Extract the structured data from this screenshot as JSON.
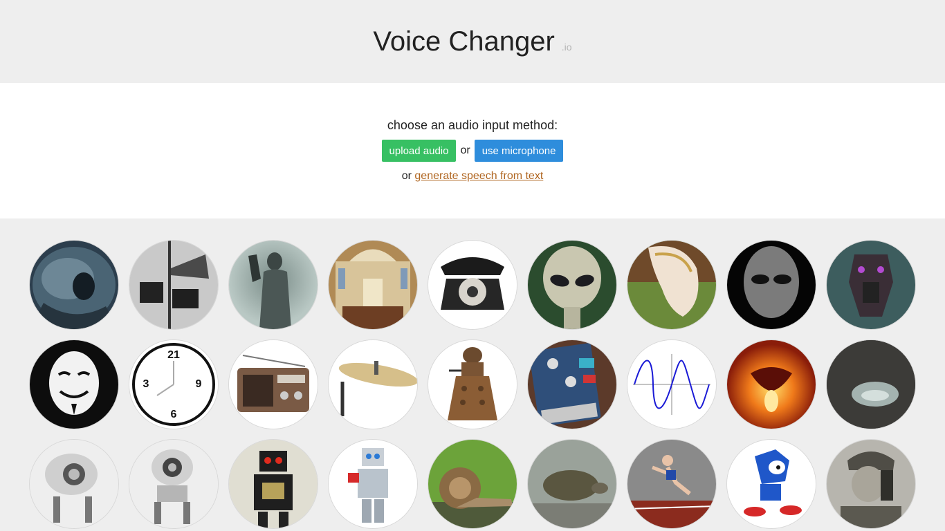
{
  "header": {
    "title": "Voice Changer",
    "tld": ".io"
  },
  "input": {
    "prompt": "choose an audio input method:",
    "upload_label": "upload audio",
    "or_label": "or",
    "mic_label": "use microphone",
    "alt_prefix": "or",
    "tts_link": "generate speech from text"
  },
  "voices": [
    {
      "name": "monster-icon"
    },
    {
      "name": "megaphone-icon"
    },
    {
      "name": "ghost-icon"
    },
    {
      "name": "cathedral-icon"
    },
    {
      "name": "telephone-icon"
    },
    {
      "name": "alien-icon"
    },
    {
      "name": "melting-clock-icon"
    },
    {
      "name": "grey-alien-icon"
    },
    {
      "name": "robot-mech-icon"
    },
    {
      "name": "anonymous-mask-icon"
    },
    {
      "name": "reversed-clock-icon"
    },
    {
      "name": "radio-icon"
    },
    {
      "name": "cymbal-icon"
    },
    {
      "name": "dalek-icon"
    },
    {
      "name": "effects-pedal-icon"
    },
    {
      "name": "sine-wave-icon"
    },
    {
      "name": "fire-demon-icon"
    },
    {
      "name": "cave-icon"
    },
    {
      "name": "robot-cat-icon"
    },
    {
      "name": "robot-cyclops-icon"
    },
    {
      "name": "toy-robot-icon"
    },
    {
      "name": "lego-robot-icon"
    },
    {
      "name": "snail-icon"
    },
    {
      "name": "turtle-icon"
    },
    {
      "name": "sprinter-icon"
    },
    {
      "name": "sonic-icon"
    },
    {
      "name": "soldier-radio-icon"
    }
  ]
}
